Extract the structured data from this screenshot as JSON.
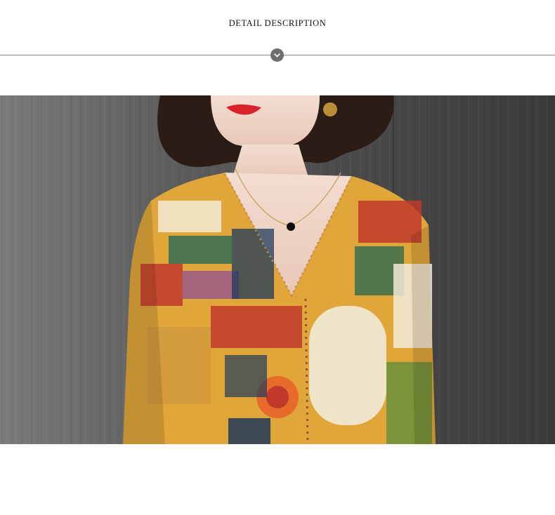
{
  "section": {
    "title": "DETAIL DESCRIPTION",
    "divider_icon": "chevron-down-icon"
  },
  "product_photo": {
    "subject": "model-wearing-printed-blouse",
    "background": "#6b6b6b",
    "accent_colors": [
      "#c0392b",
      "#e0a63a",
      "#2f6b4f",
      "#1f3b5b",
      "#f1ead8"
    ]
  }
}
